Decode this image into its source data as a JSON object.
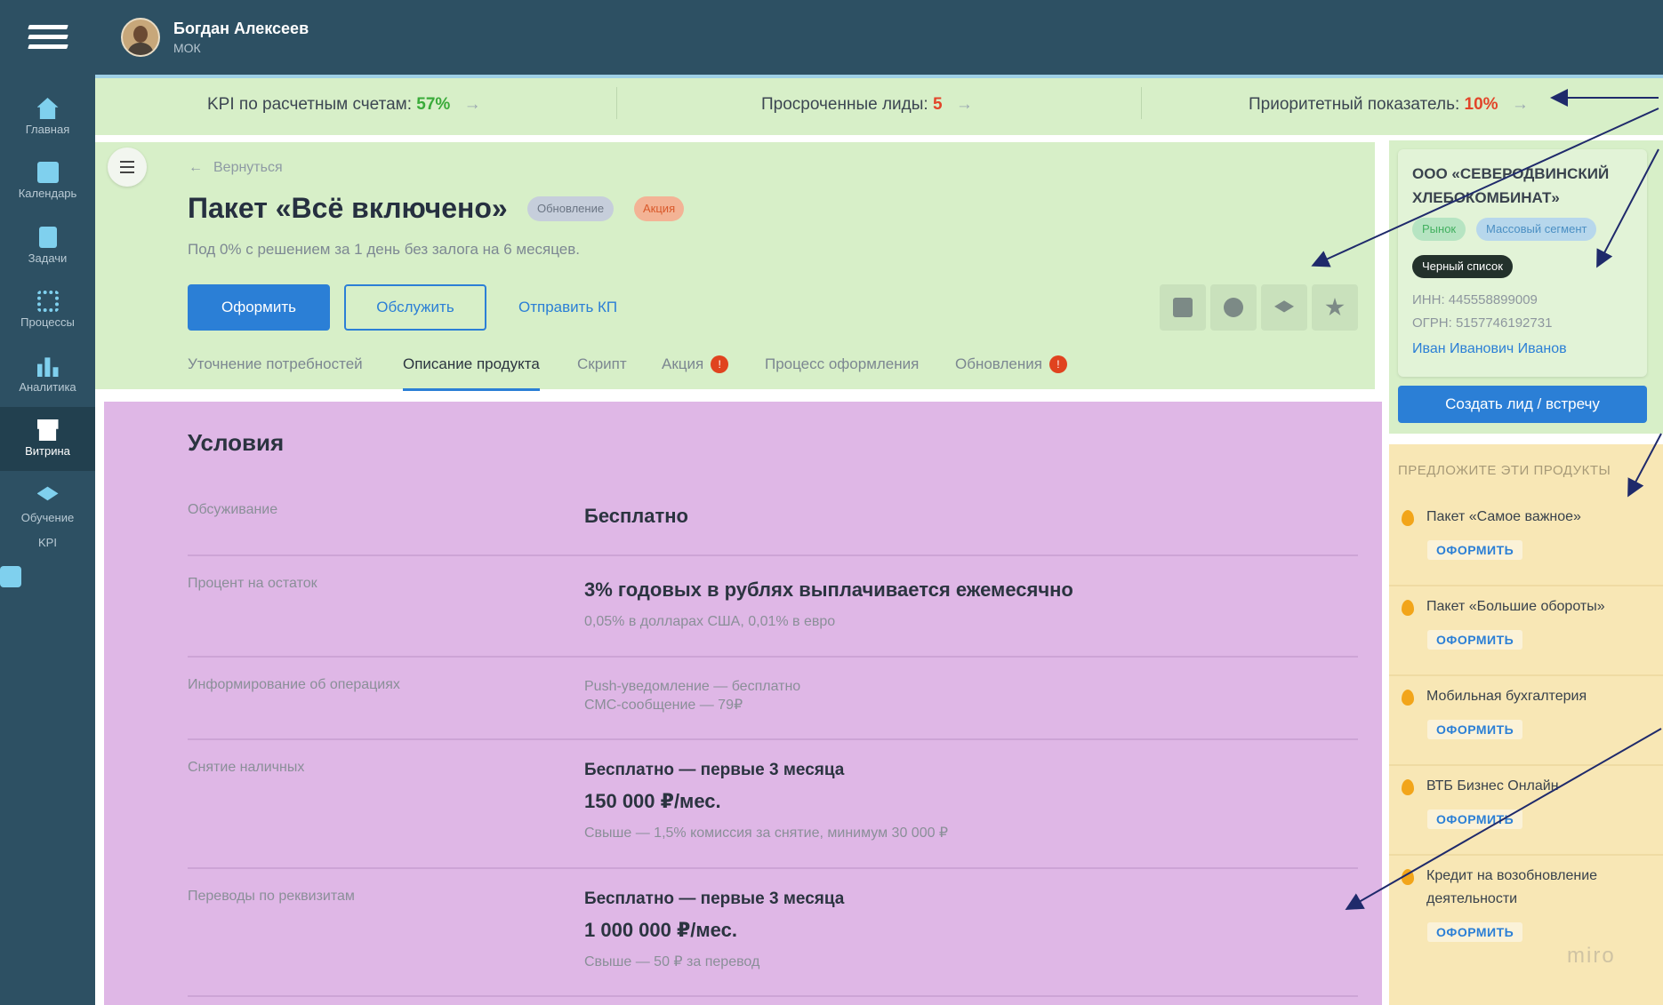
{
  "header": {
    "user_name": "Богдан Алексеев",
    "user_role": "МОК"
  },
  "sidebar": {
    "items": [
      {
        "label": "Главная",
        "icon": "home-icon"
      },
      {
        "label": "Календарь",
        "icon": "calendar-icon"
      },
      {
        "label": "Задачи",
        "icon": "tasks-icon"
      },
      {
        "label": "Процессы",
        "icon": "processes-icon"
      },
      {
        "label": "Аналитика",
        "icon": "analytics-icon"
      },
      {
        "label": "Витрина",
        "icon": "showcase-icon",
        "active": true
      },
      {
        "label": "Обучение",
        "icon": "education-icon"
      },
      {
        "label": "KPI",
        "icon": "kpi-icon"
      }
    ]
  },
  "kpi_bar": {
    "items": [
      {
        "label": "KPI по расчетным счетам:",
        "value": "57%",
        "value_color": "#3aab3a"
      },
      {
        "label": "Просроченные лиды:",
        "value": "5",
        "value_color": "#e2452a"
      },
      {
        "label": "Приоритетный показатель:",
        "value": "10%",
        "value_color": "#e2452a"
      }
    ],
    "arrow": "→"
  },
  "product": {
    "back_label": "Вернуться",
    "title": "Пакет «Всё включено»",
    "badges": [
      "Обновление",
      "Акция"
    ],
    "subtitle": "Под 0% с решением за 1 день без залога на 6 месяцев.",
    "actions": {
      "primary": "Оформить",
      "secondary": "Обслужить",
      "link": "Отправить КП"
    },
    "tool_icons": [
      "document-icon",
      "w-circle-icon",
      "graduation-cap-icon",
      "star-icon"
    ],
    "tabs": [
      {
        "label": "Уточнение потребностей",
        "count": null
      },
      {
        "label": "Описание продукта",
        "count": null,
        "active": true
      },
      {
        "label": "Скрипт",
        "count": null
      },
      {
        "label": "Акция",
        "count": "!"
      },
      {
        "label": "Процесс оформления",
        "count": null
      },
      {
        "label": "Обновления",
        "count": "!"
      }
    ]
  },
  "conditions": {
    "title": "Условия",
    "rows": [
      {
        "label": "Обсуживание",
        "main": "Бесплатно"
      },
      {
        "label": "Процент на остаток",
        "main": "3% годовых в рублях выплачивается ежемесячно",
        "sub": "0,05% в долларах США, 0,01% в евро"
      },
      {
        "label": "Информирование об операциях",
        "line1": "Push-уведомление — бесплатно",
        "line2": "СМС-сообщение — 79₽"
      },
      {
        "label": "Снятие наличных",
        "main_small": "Бесплатно — первые 3 месяца",
        "main": "150 000 ₽/мес.",
        "sub": "Свыше — 1,5% комиссия за снятие, минимум 30 000 ₽"
      },
      {
        "label": "Переводы по реквизитам",
        "main_small": "Бесплатно — первые 3 месяца",
        "main": "1 000 000 ₽/мес.",
        "sub": "Свыше — 50 ₽ за перевод"
      }
    ]
  },
  "client": {
    "name": "ООО «СЕВЕРОДВИНСКИЙ ХЛЕБОКОМБИНАТ»",
    "chips": [
      "Рынок",
      "Массовый сегмент",
      "Черный список"
    ],
    "inn": "ИНН: 445558899009",
    "ogrn": "ОГРН: 5157746192731",
    "person": "Иван Иванович Иванов",
    "lead_button": "Создать лид / встречу"
  },
  "offers": {
    "title": "ПРЕДЛОЖИТЕ ЭТИ ПРОДУКТЫ",
    "button_label": "ОФОРМИТЬ",
    "items": [
      "Пакет «Самое важное»",
      "Пакет «Большие обороты»",
      "Мобильная бухгалтерия",
      "ВТБ Бизнес Онлайн",
      "Кредит на возобновление деятельности"
    ]
  },
  "watermark": "miro"
}
